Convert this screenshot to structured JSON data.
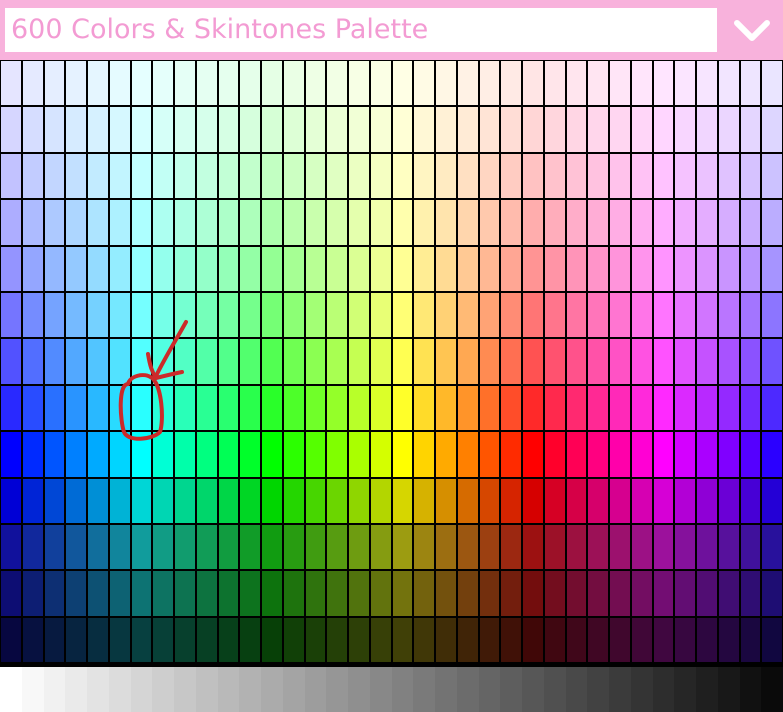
{
  "palette": {
    "title": "600 Colors & Skintones Palette",
    "dropdown_icon": "chevron-down-icon",
    "header_color": "#f8b2dc",
    "title_color": "#f39bd3",
    "columns": 36,
    "color_rows": 13,
    "grayscale_row": true
  },
  "annotation": {
    "color": "#cc2a2a",
    "shapes": [
      "red-arrow-icon",
      "red-circle-icon"
    ]
  }
}
